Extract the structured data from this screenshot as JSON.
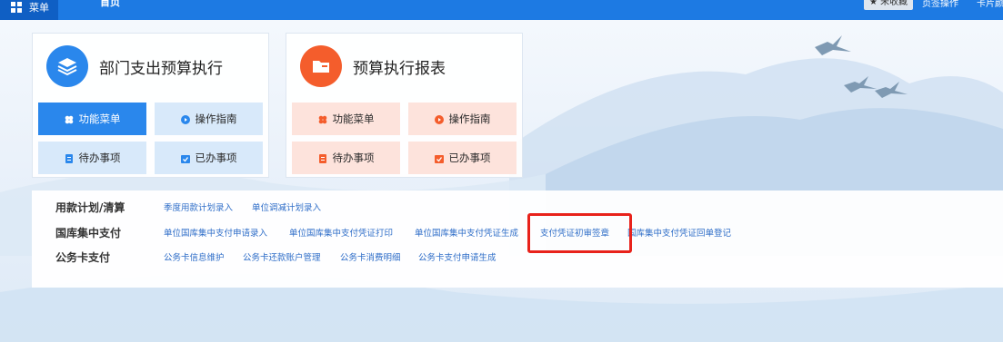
{
  "topbar": {
    "menu_label": "菜单",
    "home_tab": "首页",
    "favorites_label": "★ 未收藏",
    "page_ops_label": "页签操作",
    "user_label": "卡片颜"
  },
  "cards": [
    {
      "title": "部门支出预算执行",
      "tiles": [
        "功能菜单",
        "操作指南",
        "待办事项",
        "已办事项"
      ]
    },
    {
      "title": "预算执行报表",
      "tiles": [
        "功能菜单",
        "操作指南",
        "待办事项",
        "已办事项"
      ]
    }
  ],
  "sections": [
    {
      "heading": "用款计划/清算",
      "links": [
        "季度用款计划录入",
        "单位调减计划录入"
      ]
    },
    {
      "heading": "国库集中支付",
      "links": [
        "单位国库集中支付申请录入",
        "单位国库集中支付凭证打印",
        "单位国库集中支付凭证生成",
        "支付凭证初审签章",
        "国库集中支付凭证回单登记"
      ]
    },
    {
      "heading": "公务卡支付",
      "links": [
        "公务卡信息维护",
        "公务卡还款账户管理",
        "公务卡消费明细",
        "公务卡支付申请生成"
      ]
    }
  ],
  "colors": {
    "topbar": "#1d7ae3",
    "primary": "#2a87ec",
    "report": "#f45d2c",
    "link": "#2f6ec8",
    "highlight_box": "#e8221b"
  }
}
